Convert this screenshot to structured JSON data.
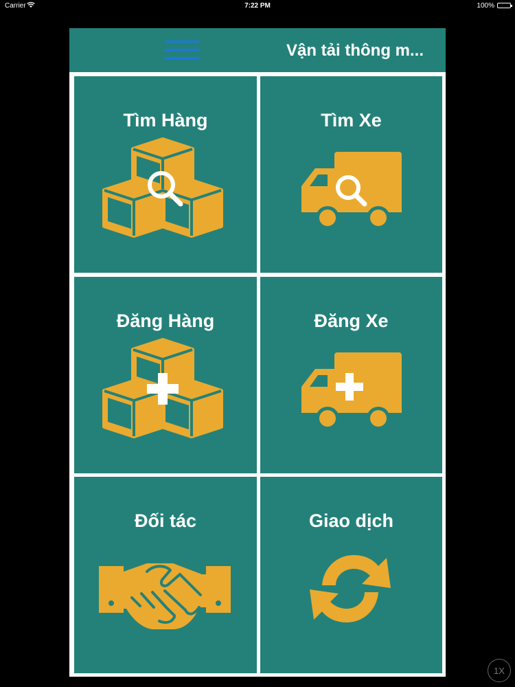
{
  "status_bar": {
    "carrier": "Carrier",
    "time": "7:22 PM",
    "battery": "100%"
  },
  "header": {
    "title": "Vận tải thông m...",
    "menu_icon": "hamburger-menu-icon"
  },
  "tiles": [
    {
      "label": "Tìm Hàng",
      "icon": "boxes-search-icon"
    },
    {
      "label": "Tìm Xe",
      "icon": "truck-search-icon"
    },
    {
      "label": "Đăng Hàng",
      "icon": "boxes-add-icon"
    },
    {
      "label": "Đăng Xe",
      "icon": "truck-add-icon"
    },
    {
      "label": "Đối tác",
      "icon": "handshake-icon"
    },
    {
      "label": "Giao dịch",
      "icon": "sync-arrows-icon"
    }
  ],
  "simulator_badge": "1X",
  "colors": {
    "tile_bg": "#248179",
    "icon": "#EAAA2F",
    "menu_icon": "#1C77E4"
  }
}
